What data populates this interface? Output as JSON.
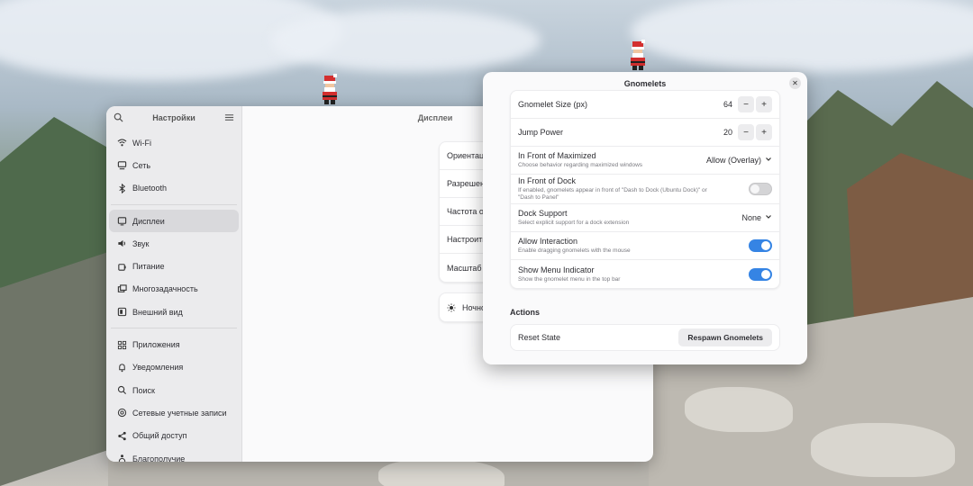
{
  "settings": {
    "sidebar_title": "Настройки",
    "main_title": "Дисплеи",
    "sidebar_items": [
      {
        "label": "Wi-Fi",
        "icon": "wifi-icon"
      },
      {
        "label": "Сеть",
        "icon": "network-icon"
      },
      {
        "label": "Bluetooth",
        "icon": "bluetooth-icon"
      },
      {
        "label": "Дисплеи",
        "icon": "display-icon",
        "active": true
      },
      {
        "label": "Звук",
        "icon": "sound-icon"
      },
      {
        "label": "Питание",
        "icon": "power-icon"
      },
      {
        "label": "Многозадачность",
        "icon": "multitasking-icon"
      },
      {
        "label": "Внешний вид",
        "icon": "appearance-icon"
      },
      {
        "label": "Приложения",
        "icon": "apps-icon"
      },
      {
        "label": "Уведомления",
        "icon": "bell-icon"
      },
      {
        "label": "Поиск",
        "icon": "search-icon"
      },
      {
        "label": "Сетевые учетные записи",
        "icon": "online-accounts-icon"
      },
      {
        "label": "Общий доступ",
        "icon": "share-icon"
      },
      {
        "label": "Благополучие",
        "icon": "wellbeing-icon"
      }
    ],
    "display_rows": [
      "Ориентация",
      "Разрешение",
      "Частота обновления",
      "Настроить для ТВ",
      "Масштаб"
    ],
    "night_light": "Ночной свет"
  },
  "gnomelets": {
    "title": "Gnomelets",
    "size_label": "Gnomelet Size (px)",
    "size_value": "64",
    "jump_label": "Jump Power",
    "jump_value": "20",
    "maximized_label": "In Front of Maximized",
    "maximized_sub": "Choose behavior regarding maximized windows",
    "maximized_value": "Allow (Overlay)",
    "dock_label": "In Front of Dock",
    "dock_sub_1": "If enabled, gnomelets appear in front of \"Dash to Dock (Ubuntu Dock)\" or",
    "dock_sub_2": "\"Dash to Panel\"",
    "dock_toggle": false,
    "dock_support_label": "Dock Support",
    "dock_support_sub": "Select explicit support for a dock extension",
    "dock_support_value": "None",
    "interaction_label": "Allow Interaction",
    "interaction_sub": "Enable dragging gnomelets with the mouse",
    "interaction_toggle": true,
    "menu_label": "Show Menu Indicator",
    "menu_sub": "Show the gnomelet menu in the top bar",
    "menu_toggle": true,
    "actions_title": "Actions",
    "reset_label": "Reset State",
    "respawn_label": "Respawn Gnomelets"
  },
  "colors": {
    "accent": "#3584e4",
    "window_bg": "#fafafb",
    "sidebar_bg": "#ebebed"
  }
}
